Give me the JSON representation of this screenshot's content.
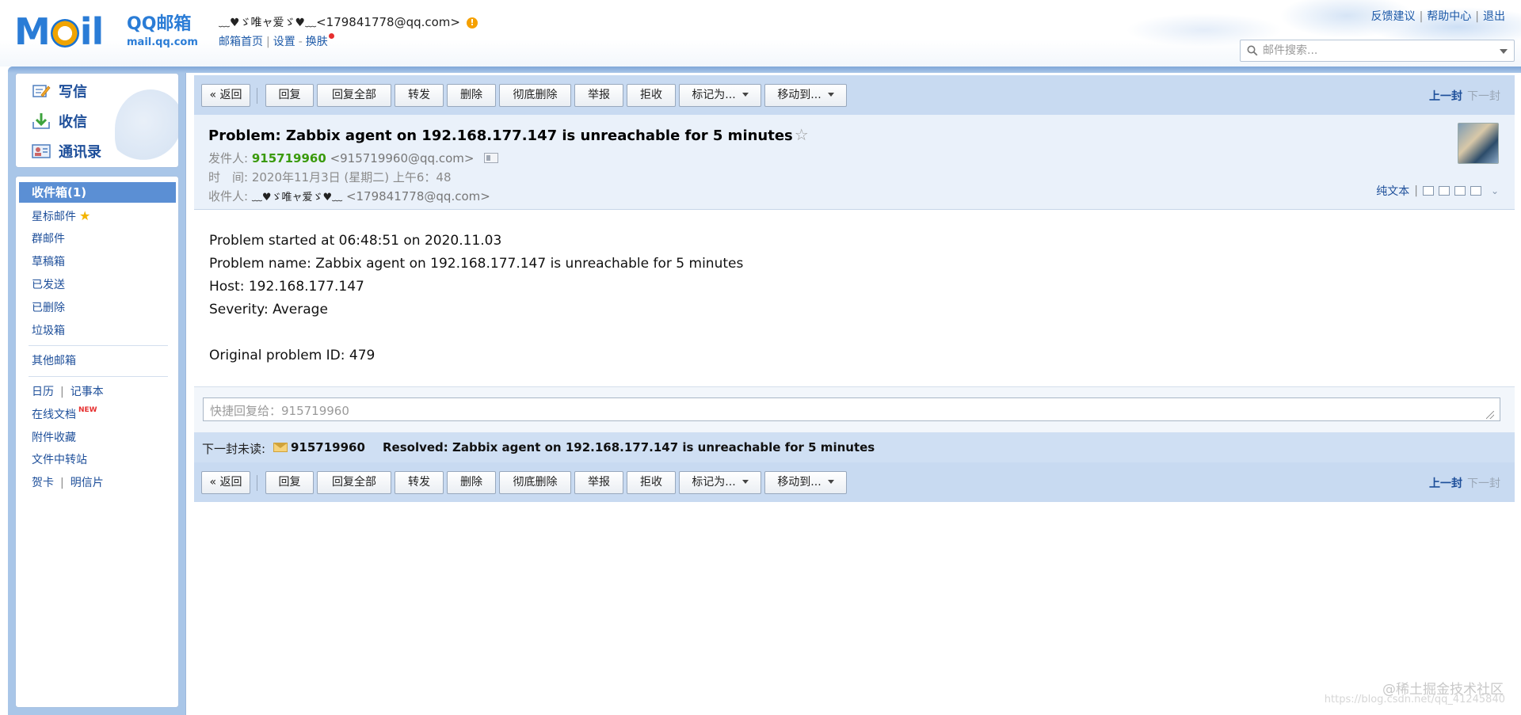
{
  "app": {
    "brand": "QQ邮箱",
    "domain": "mail.qq.com",
    "logo_text": "MAIL"
  },
  "user": {
    "nickname": "﹏♥ゞ唯ャ爱ゞ♥﹏",
    "email": "<179841778@qq.com>",
    "links": [
      "邮箱首页",
      "设置",
      "换肤"
    ]
  },
  "top_links": [
    "反馈建议",
    "帮助中心",
    "退出"
  ],
  "search": {
    "placeholder": "邮件搜索..."
  },
  "sidebar": {
    "actions": [
      {
        "label": "写信",
        "icon": "compose-icon"
      },
      {
        "label": "收信",
        "icon": "inbox-download-icon"
      },
      {
        "label": "通讯录",
        "icon": "contacts-icon"
      }
    ],
    "active_folder": "收件箱(1)",
    "folders": [
      "星标邮件",
      "群邮件",
      "草稿箱",
      "已发送",
      "已删除",
      "垃圾箱"
    ],
    "other": "其他邮箱",
    "tools": {
      "calendar": "日历",
      "notes": "记事本",
      "docs": "在线文档",
      "new_badge": "NEW",
      "attachments": "附件收藏",
      "transfer": "文件中转站",
      "cards": "贺卡",
      "postcards": "明信片"
    }
  },
  "toolbar": {
    "back": "« 返回",
    "reply": "回复",
    "reply_all": "回复全部",
    "forward": "转发",
    "delete": "删除",
    "delete_forever": "彻底删除",
    "report": "举报",
    "reject": "拒收",
    "mark_as": "标记为...",
    "move_to": "移动到...",
    "prev": "上一封",
    "next": "下一封"
  },
  "mail": {
    "subject": "Problem: Zabbix agent on 192.168.177.147 is unreachable for 5 minutes",
    "star": "☆",
    "from_label": "发件人:",
    "from_name": "915719960",
    "from_addr": "<915719960@qq.com>",
    "time_label": "时　间:",
    "time": "2020年11月3日 (星期二) 上午6：48",
    "to_label": "收件人:",
    "to_name": "﹏♥ゞ唯ャ爱ゞ♥﹏",
    "to_addr": "<179841778@qq.com>",
    "plain_text": "纯文本",
    "body": [
      "Problem started at 06:48:51 on 2020.11.03",
      "Problem name: Zabbix agent on 192.168.177.147 is unreachable for 5 minutes",
      "Host: 192.168.177.147",
      "Severity: Average",
      "",
      "Original problem ID: 479"
    ]
  },
  "quick_reply": {
    "placeholder": "快捷回复给：915719960"
  },
  "next_unread": {
    "label": "下一封未读:",
    "from": "915719960",
    "subject": "Resolved: Zabbix agent on 192.168.177.147 is unreachable for 5 minutes"
  },
  "watermark": {
    "text": "@稀土掘金技术社区",
    "url": "https://blog.csdn.net/qq_41245840"
  }
}
